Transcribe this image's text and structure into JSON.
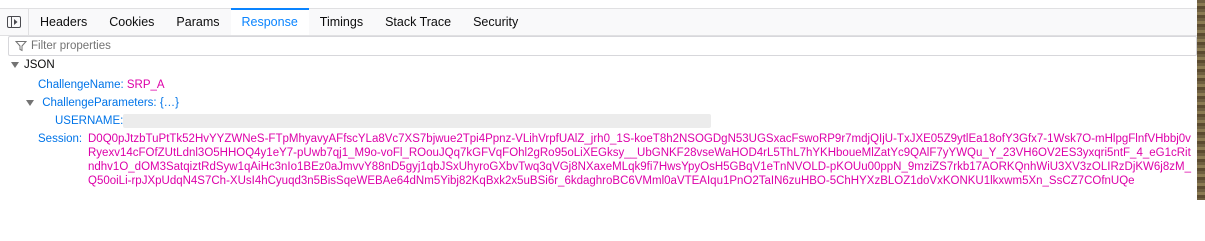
{
  "tabs": [
    {
      "label": "Headers"
    },
    {
      "label": "Cookies"
    },
    {
      "label": "Params"
    },
    {
      "label": "Response"
    },
    {
      "label": "Timings"
    },
    {
      "label": "Stack Trace"
    },
    {
      "label": "Security"
    }
  ],
  "active_tab": "Response",
  "filter": {
    "placeholder": "Filter properties",
    "value": ""
  },
  "json": {
    "root_label": "JSON",
    "challenge_name_key": "ChallengeName:",
    "challenge_name_value": "SRP_A",
    "challenge_params_key": "ChallengeParameters:",
    "challenge_params_value": "{…}",
    "username_key": "USERNAME:",
    "session_key": "Session:",
    "session_value": "D0Q0pJtzbTuPtTk52HvYYZWNeS-FTpMhyavyAFfscYLa8Vc7XS7bjwue2Tpi4Ppnz-VLihVrpfUAlZ_jrh0_1S-koeT8h2NSOGDgN53UGSxacFswoRP9r7mdjQIjU-TxJXE05Z9ytlEa18ofY3Gfx7-1Wsk7O-mHlpgFlnfVHbbj0vRyexv14cFOfZUtLdnl3O5HHOQ4y1eY7-pUwb7qj1_M9o-voFl_ROouJQq7kGFVqFOhl2gRo95oLiXEGksy__UbGNKF28vseWaHOD4rL5ThL7hYKHboueMlZatYc9QAlF7yYWQu_Y_23VH6OV2ES3yxqri5ntF_4_eG1cRitndhv1O_dOM3SatqiztRdSyw1qAiHc3nIo1BEz0aJmvvY88nD5gyj1qbJSxUhyroGXbvTwq3qVGj8NXaxeMLqk9fi7HwsYpyOsH5GBqV1eTnNVOLD-pKOUu00ppN_9mziZS7rkb17AORKQnhWiU3XV3zOLIRzDjKW6j8zM_Q50oiLi-rpJXpUdqN4S7Ch-XUsI4hCyuqd3n5BisSqeWEBAe64dNm5Yibj82KqBxk2x5uBSi6r_6kdaghroBC6VMml0aVTEAIqu1PnO2TaIN6zuHBO-5ChHYXzBLOZ1doVxKONKU1lkxwm5Xn_SsCZ7COfnUQe"
  }
}
